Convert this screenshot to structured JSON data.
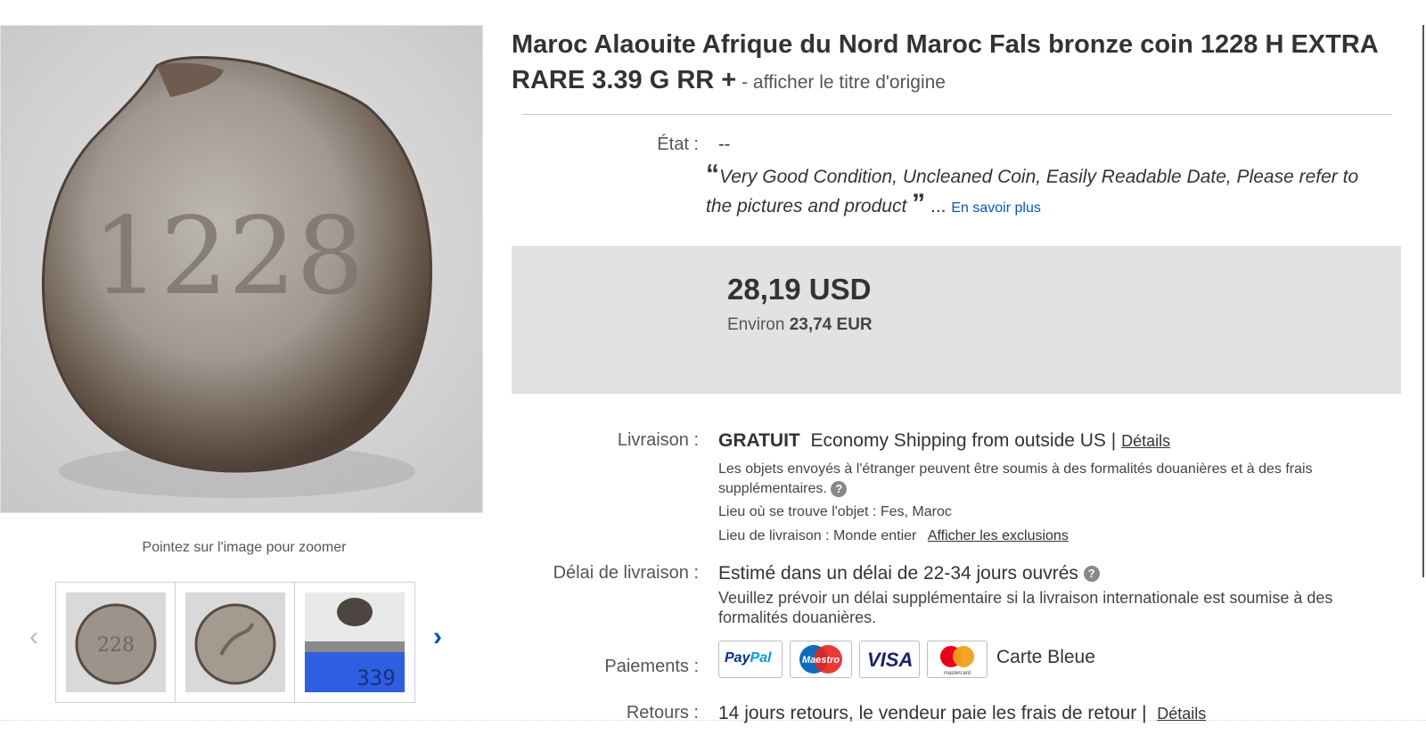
{
  "gallery": {
    "zoom_hint": "Pointez sur l'image pour zoomer",
    "main_image_date": "1228",
    "thumbnails": [
      {
        "name": "thumbnail-obverse",
        "label": "228"
      },
      {
        "name": "thumbnail-reverse",
        "label": ""
      },
      {
        "name": "thumbnail-scale",
        "label": "339"
      }
    ]
  },
  "listing": {
    "title": "Maroc Alaouite Afrique du Nord Maroc Fals bronze coin 1228 H EXTRA RARE 3.39 G RR +",
    "title_separator": " - ",
    "original_title_link": "afficher le titre d'origine"
  },
  "condition": {
    "label": "État :",
    "value": "--",
    "open_quote": "“",
    "description": "Very Good Condition, Uncleaned Coin, Easily Readable Date, Please refer to the pictures and product",
    "close_quote": "”",
    "ellipsis": " ... ",
    "more_link": "En savoir plus"
  },
  "price": {
    "amount": "28,19 USD",
    "approx_prefix": "Environ ",
    "approx_value": "23,74 EUR"
  },
  "shipping": {
    "label": "Livraison :",
    "cost": "GRATUIT",
    "service": "Economy Shipping from outside US",
    "sep": "|",
    "details_link": "Détails",
    "customs_note": "Les objets envoyés à l'étranger peuvent être soumis à des formalités douanières et à des frais supplémentaires.",
    "location_label": "Lieu où se trouve l'objet :",
    "location_value": "Fes, Maroc",
    "ships_to_label": "Lieu de livraison :",
    "ships_to_value": "Monde entier",
    "exclusions_link": "Afficher les exclusions"
  },
  "delivery": {
    "label": "Délai de livraison :",
    "estimate": "Estimé dans un délai de 22-34 jours ouvrés",
    "note": "Veuillez prévoir un délai supplémentaire si la livraison internationale est soumise à des formalités douanières."
  },
  "payments": {
    "label": "Paiements :",
    "paypal": "PayPal",
    "maestro": "Maestro",
    "visa": "VISA",
    "mastercard_caption": "mastercard",
    "carte_bleue": "Carte Bleue"
  },
  "returns": {
    "label": "Retours :",
    "text": "14 jours retours, le vendeur paie les frais de retour",
    "sep": "|",
    "details_link": "Détails"
  },
  "colors": {
    "link_blue": "#0654ba",
    "price_box": "#e2e2e2",
    "paypal_dark": "#003087",
    "paypal_light": "#009cde",
    "maestro_blue": "#0e6cbf",
    "maestro_red": "#e6261f",
    "visa_blue": "#1a1f71",
    "mc_red": "#eb001b",
    "mc_orange": "#f79e1b"
  },
  "icons": [
    "chevron-left-icon",
    "chevron-right-icon",
    "help-icon",
    "paypal-logo",
    "maestro-logo",
    "visa-logo",
    "mastercard-logo"
  ]
}
